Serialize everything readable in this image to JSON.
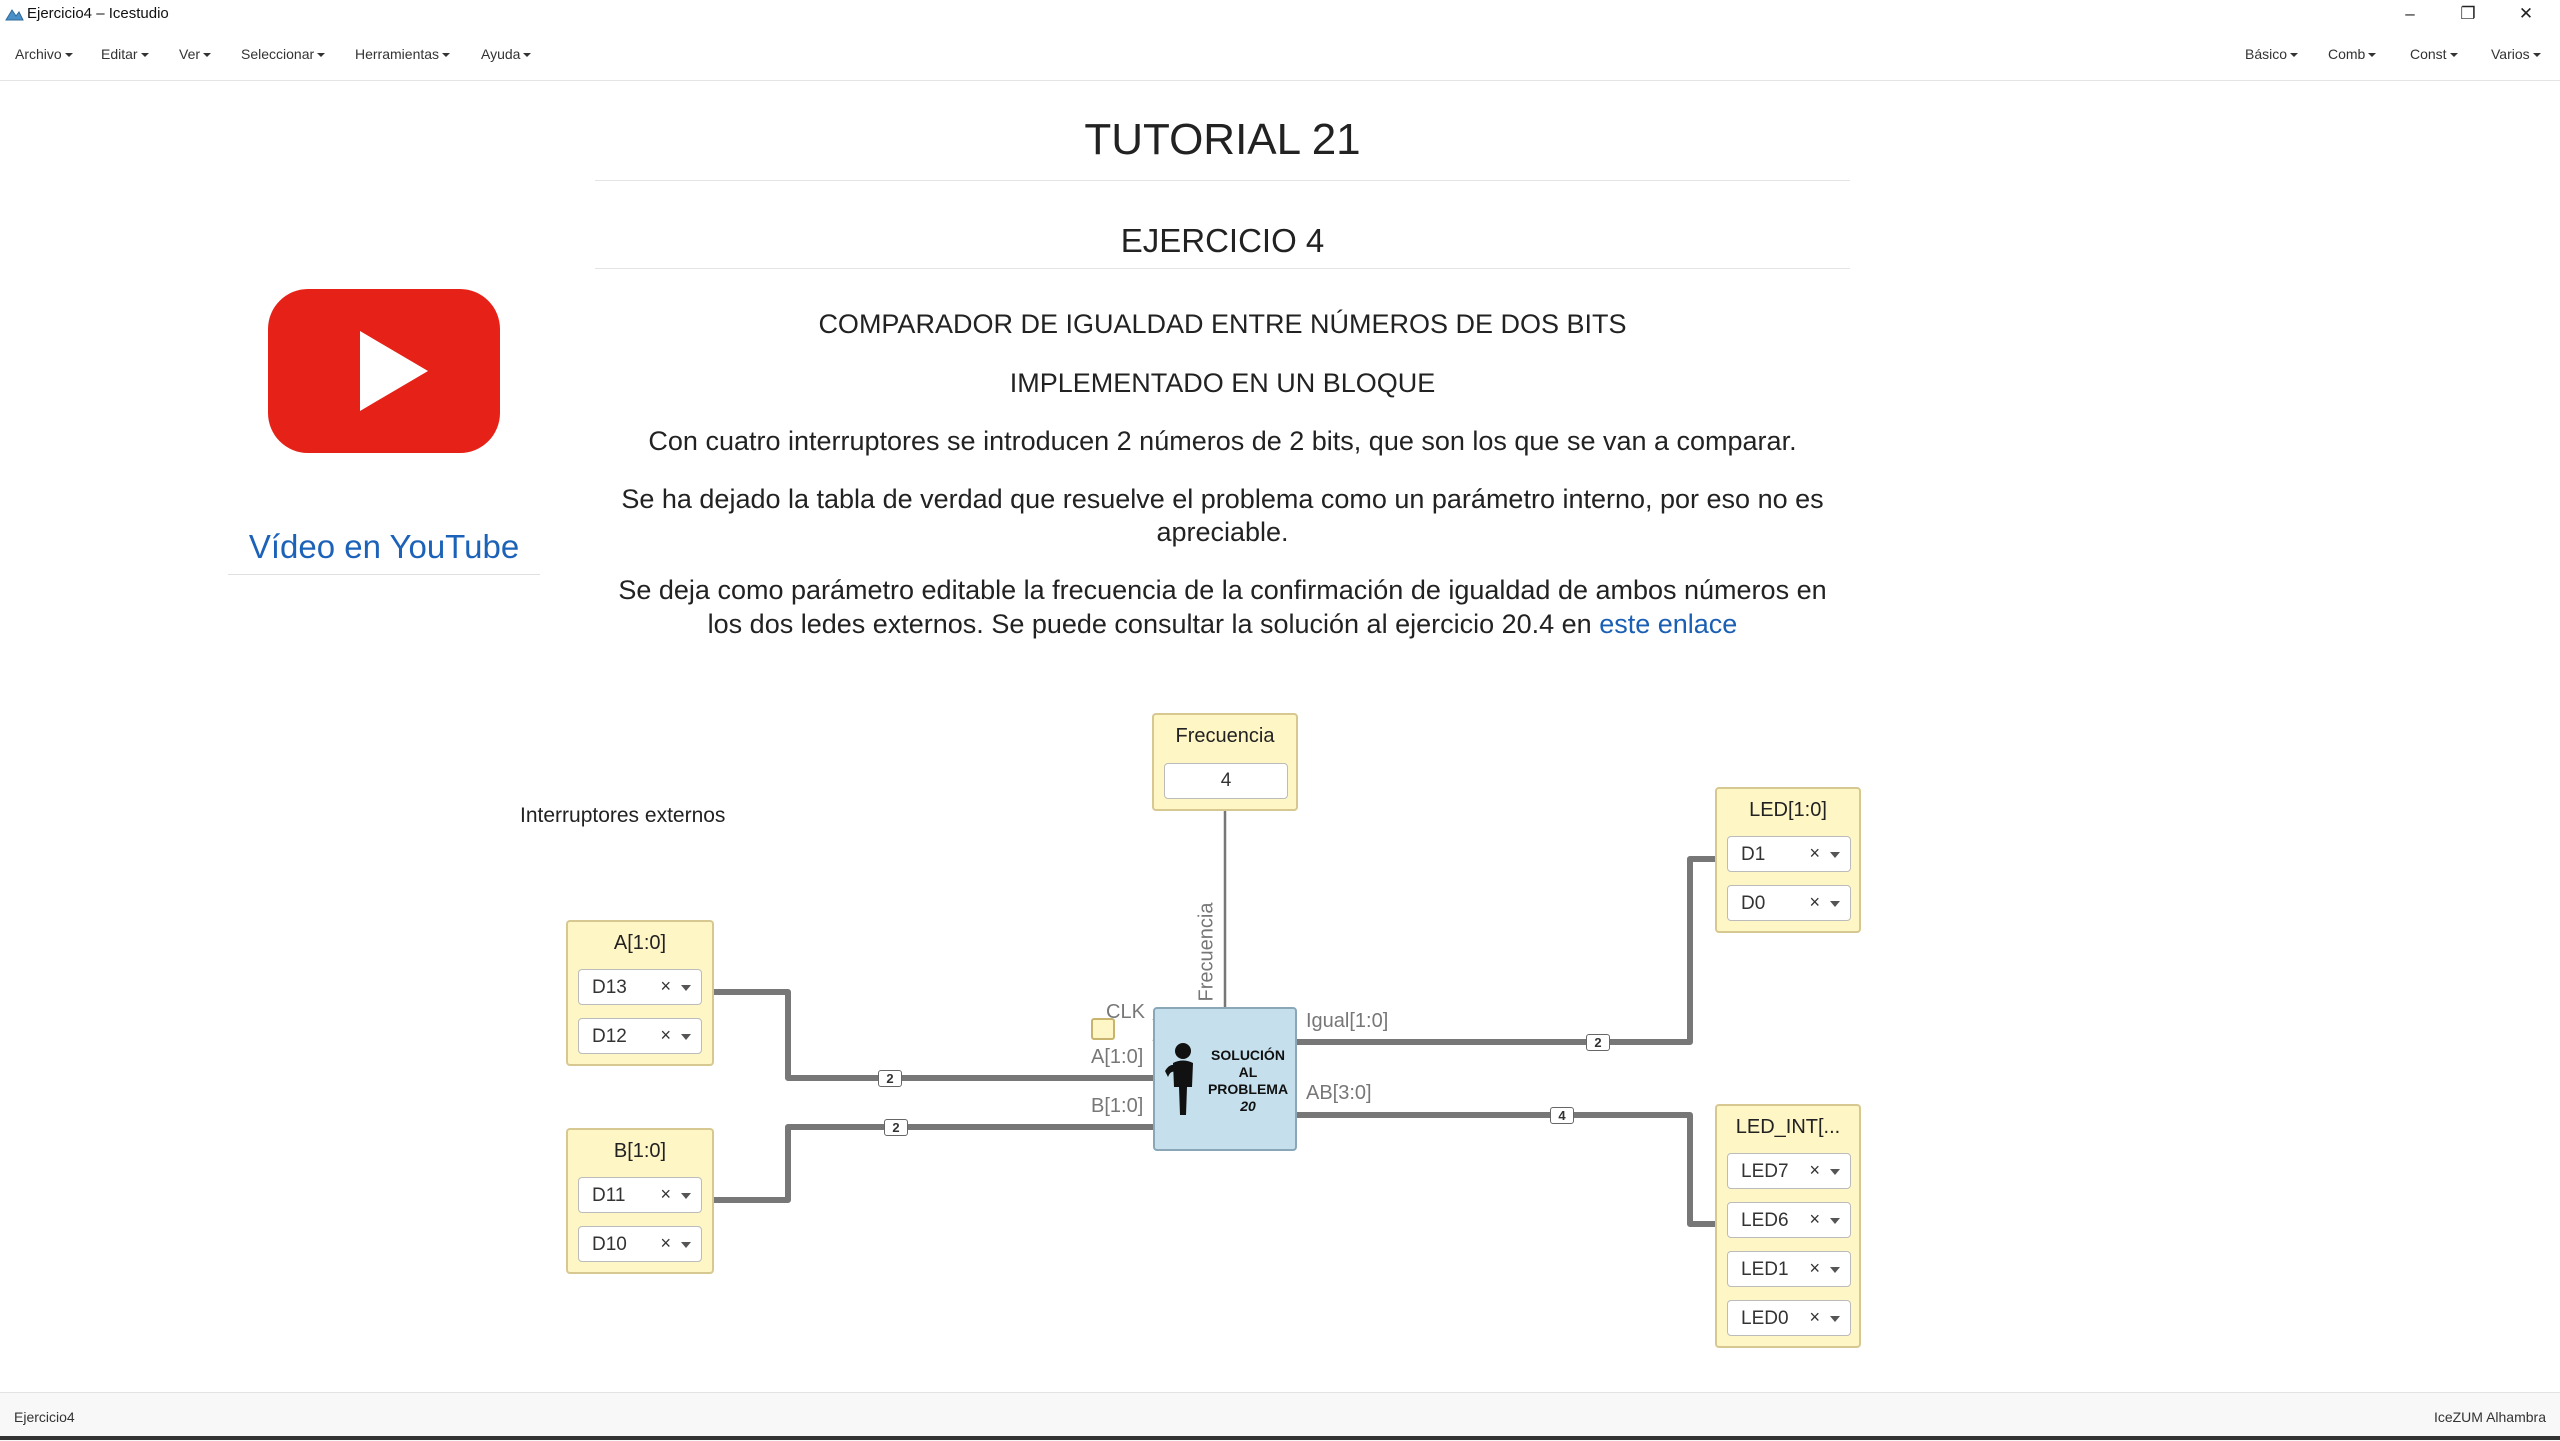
{
  "window": {
    "title": "Ejercicio4 – Icestudio",
    "minimize": "–",
    "restore": "❐",
    "close": "✕"
  },
  "menu_left": [
    "Archivo",
    "Editar",
    "Ver",
    "Seleccionar",
    "Herramientas",
    "Ayuda"
  ],
  "menu_right": [
    "Básico",
    "Comb",
    "Const",
    "Varios"
  ],
  "info": {
    "title": "TUTORIAL 21",
    "subtitle": "EJERCICIO 4",
    "line1": "COMPARADOR DE IGUALDAD ENTRE NÚMEROS DE DOS BITS",
    "line2": "IMPLEMENTADO EN UN BLOQUE",
    "para1": "Con cuatro interruptores se introducen 2 números de 2 bits, que son los que se van a comparar.",
    "para2_a": "Se ha dejado la tabla de verdad que resuelve el problema como un parámetro interno, por eso no es",
    "para2_b": "apreciable.",
    "para3_a": "Se deja como parámetro editable la frecuencia de la confirmación de igualdad de ambos números en",
    "para3_b": "los dos ledes externos. Se puede consultar la solución al ejercicio 20.4 en",
    "para3_link": "este enlace"
  },
  "youtube": {
    "link_text": "Vídeo en YouTube",
    "brand_color": "#e62117"
  },
  "circuit": {
    "comment": "Interruptores externos",
    "frecuencia": {
      "title": "Frecuencia",
      "value": "4",
      "wire_label": "Frecuencia"
    },
    "input_a": {
      "title": "A[1:0]",
      "pins": [
        "D13",
        "D12"
      ],
      "bus": "2"
    },
    "input_b": {
      "title": "B[1:0]",
      "pins": [
        "D11",
        "D10"
      ],
      "bus": "2"
    },
    "output_led": {
      "title": "LED[1:0]",
      "pins": [
        "D1",
        "D0"
      ],
      "bus": "2"
    },
    "output_led_int": {
      "title": "LED_INT[...",
      "pins": [
        "LED7",
        "LED6",
        "LED1",
        "LED0"
      ],
      "bus": "4"
    },
    "solver": {
      "line1": "SOLUCIÓN",
      "line2": "AL",
      "line3": "PROBLEMA",
      "line4": "20",
      "port_clk": "CLK",
      "port_a": "A[1:0]",
      "port_b": "B[1:0]",
      "port_igual": "Igual[1:0]",
      "port_ab": "AB[3:0]"
    },
    "pin_clear": "×"
  },
  "status": {
    "left": "Ejercicio4",
    "right": "IceZUM Alhambra"
  }
}
